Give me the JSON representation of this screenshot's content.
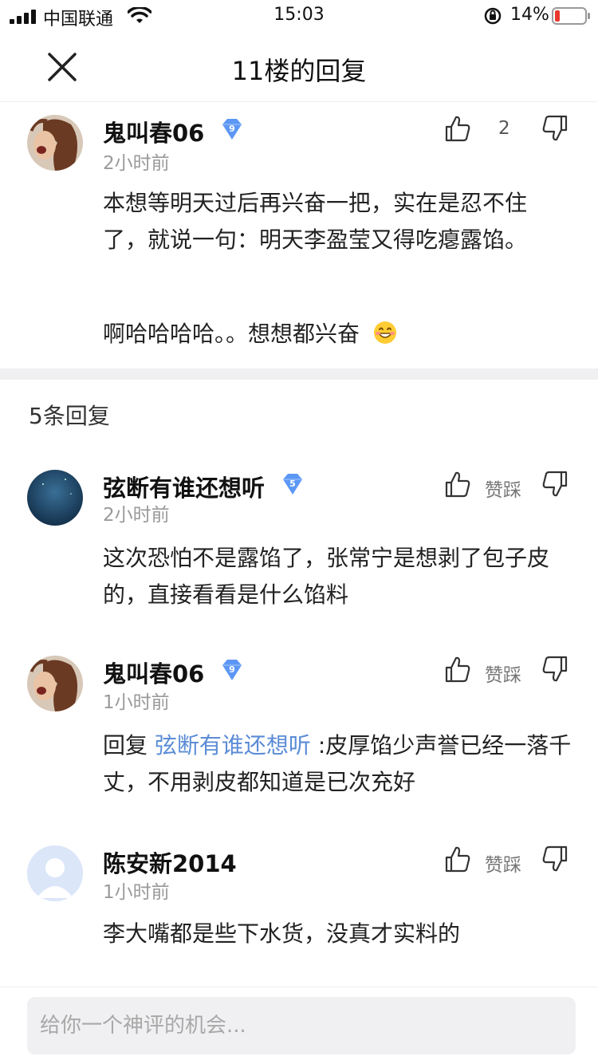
{
  "status_bar": {
    "carrier": "中国联通",
    "time": "15:03",
    "battery": "14%"
  },
  "nav": {
    "title": "11楼的回复",
    "close_icon": "close-icon"
  },
  "main_comment": {
    "username": "鬼叫春06",
    "level": "9",
    "timestamp": "2小时前",
    "like_count": "2",
    "paragraph1": "本想等明天过后再兴奋一把，实在是忍不住了，就说一句：明天李盈莹又得吃瘪露馅。",
    "paragraph2": "啊哈哈哈哈。。想想都兴奋"
  },
  "replies_header": "5条回复",
  "replies": [
    {
      "username": "弦断有谁还想听",
      "level": "5",
      "timestamp": "2小时前",
      "like_label": "赞踩",
      "text": "这次恐怕不是露馅了，张常宁是想剥了包子皮的，直接看看是什么馅料"
    },
    {
      "username": "鬼叫春06",
      "level": "9",
      "timestamp": "1小时前",
      "like_label": "赞踩",
      "reply_prefix": "回复 ",
      "mention": "弦断有谁还想听",
      "text": " :皮厚馅少声誉已经一落千丈，不用剥皮都知道是已次充好"
    },
    {
      "username": "陈安新2014",
      "timestamp": "1小时前",
      "like_label": "赞踩",
      "text": "李大嘴都是些下水货，没真才实料的"
    }
  ],
  "input": {
    "placeholder": "给你一个神评的机会..."
  },
  "colors": {
    "mention": "#5b8cd6",
    "badge": "#5c97f5",
    "battery_low": "#e8392e"
  }
}
